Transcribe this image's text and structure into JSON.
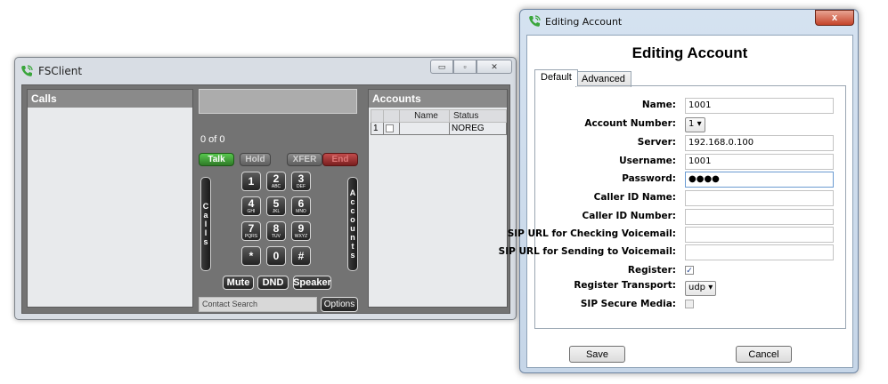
{
  "fsclient": {
    "title": "FSClient",
    "window_controls": {
      "minimize": "▭",
      "maximize": "▫",
      "close": "✕"
    },
    "calls_panel": {
      "title": "Calls"
    },
    "call_count": "0 of 0",
    "call_controls": {
      "talk": "Talk",
      "hold": "Hold",
      "xfer": "XFER",
      "end": "End"
    },
    "side_tabs": {
      "calls": [
        "C",
        "a",
        "l",
        "l",
        "s"
      ],
      "accounts": [
        "A",
        "c",
        "c",
        "o",
        "u",
        "n",
        "t",
        "s"
      ]
    },
    "keypad": [
      {
        "digit": "1",
        "letters": ""
      },
      {
        "digit": "2",
        "letters": "ABC"
      },
      {
        "digit": "3",
        "letters": "DEF"
      },
      {
        "digit": "4",
        "letters": "GHI"
      },
      {
        "digit": "5",
        "letters": "JKL"
      },
      {
        "digit": "6",
        "letters": "MNO"
      },
      {
        "digit": "7",
        "letters": "PQRS"
      },
      {
        "digit": "8",
        "letters": "TUV"
      },
      {
        "digit": "9",
        "letters": "WXYZ"
      },
      {
        "digit": "*",
        "letters": ""
      },
      {
        "digit": "0",
        "letters": ""
      },
      {
        "digit": "#",
        "letters": ""
      }
    ],
    "bottom_buttons": {
      "mute": "Mute",
      "dnd": "DND",
      "speaker": "Speaker"
    },
    "contact_search_placeholder": "Contact Search",
    "options_label": "Options",
    "accounts_panel": {
      "title": "Accounts",
      "columns": [
        "",
        "",
        "Name",
        "Status"
      ],
      "rows": [
        {
          "index": "1",
          "name": "",
          "status": "NOREG"
        }
      ]
    }
  },
  "dialog": {
    "window_title": "Editing Account",
    "close_label": "x",
    "heading": "Editing Account",
    "tabs": {
      "default": "Default",
      "advanced": "Advanced"
    },
    "fields": {
      "name": {
        "label": "Name:",
        "value": "1001"
      },
      "account_number": {
        "label": "Account Number:",
        "value": "1"
      },
      "server": {
        "label": "Server:",
        "value": "192.168.0.100"
      },
      "username": {
        "label": "Username:",
        "value": "1001"
      },
      "password": {
        "label": "Password:",
        "value": "●●●●"
      },
      "caller_id_name": {
        "label": "Caller ID Name:",
        "value": ""
      },
      "caller_id_number": {
        "label": "Caller ID Number:",
        "value": ""
      },
      "sip_url_checking": {
        "label": "SIP URL for Checking Voicemail:",
        "value": ""
      },
      "sip_url_sending": {
        "label": "SIP URL for Sending to Voicemail:",
        "value": ""
      },
      "register": {
        "label": "Register:",
        "checked": true,
        "mark": "✓"
      },
      "register_transport": {
        "label": "Register Transport:",
        "value": "udp"
      },
      "sip_secure_media": {
        "label": "SIP Secure Media:",
        "checked": false
      }
    },
    "buttons": {
      "save": "Save",
      "cancel": "Cancel"
    }
  },
  "colors": {
    "fs_background": "#737373",
    "talk_green": "#3fa335",
    "end_red": "#a83232",
    "dialog_frame": "#c6d6e8"
  }
}
